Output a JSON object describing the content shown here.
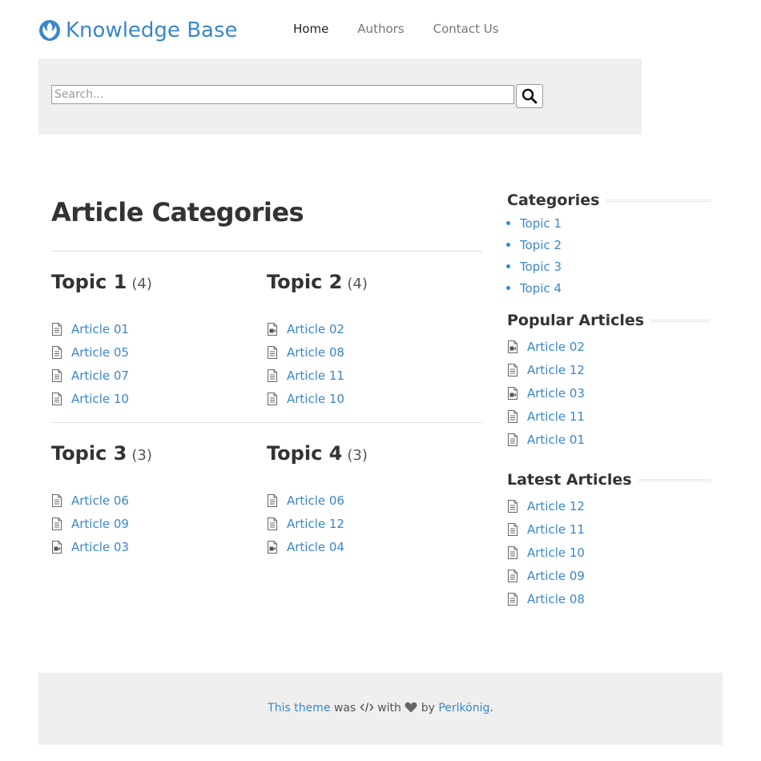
{
  "brand": {
    "name": "Knowledge Base",
    "icon": "rebel-alliance-icon",
    "color": "#3a87c8"
  },
  "nav": [
    {
      "label": "Home",
      "active": true
    },
    {
      "label": "Authors",
      "active": false
    },
    {
      "label": "Contact Us",
      "active": false
    }
  ],
  "search": {
    "placeholder": "Search...",
    "value": "",
    "button_icon": "search-icon"
  },
  "main": {
    "title": "Article Categories",
    "topics": [
      {
        "name": "Topic 1",
        "count": "(4)",
        "articles": [
          {
            "label": "Article 01",
            "icon": "document-icon"
          },
          {
            "label": "Article 05",
            "icon": "document-icon"
          },
          {
            "label": "Article 07",
            "icon": "document-icon"
          },
          {
            "label": "Article 10",
            "icon": "document-icon"
          }
        ]
      },
      {
        "name": "Topic 2",
        "count": "(4)",
        "articles": [
          {
            "label": "Article 02",
            "icon": "video-document-icon"
          },
          {
            "label": "Article 08",
            "icon": "document-icon"
          },
          {
            "label": "Article 11",
            "icon": "document-icon"
          },
          {
            "label": "Article 10",
            "icon": "document-icon"
          }
        ]
      },
      {
        "name": "Topic 3",
        "count": "(3)",
        "articles": [
          {
            "label": "Article 06",
            "icon": "document-icon"
          },
          {
            "label": "Article 09",
            "icon": "document-icon"
          },
          {
            "label": "Article 03",
            "icon": "video-document-icon"
          }
        ]
      },
      {
        "name": "Topic 4",
        "count": "(3)",
        "articles": [
          {
            "label": "Article 06",
            "icon": "document-icon"
          },
          {
            "label": "Article 12",
            "icon": "document-icon"
          },
          {
            "label": "Article 04",
            "icon": "video-document-icon"
          }
        ]
      }
    ]
  },
  "sidebar": {
    "categories": {
      "title": "Categories",
      "items": [
        "Topic 1",
        "Topic 2",
        "Topic 3",
        "Topic 4"
      ]
    },
    "popular": {
      "title": "Popular Articles",
      "items": [
        {
          "label": "Article 02",
          "icon": "video-document-icon"
        },
        {
          "label": "Article 12",
          "icon": "document-icon"
        },
        {
          "label": "Article 03",
          "icon": "video-document-icon"
        },
        {
          "label": "Article 11",
          "icon": "document-icon"
        },
        {
          "label": "Article 01",
          "icon": "document-icon"
        }
      ]
    },
    "latest": {
      "title": "Latest Articles",
      "items": [
        {
          "label": "Article 12",
          "icon": "document-icon"
        },
        {
          "label": "Article 11",
          "icon": "document-icon"
        },
        {
          "label": "Article 10",
          "icon": "document-icon"
        },
        {
          "label": "Article 09",
          "icon": "document-icon"
        },
        {
          "label": "Article 08",
          "icon": "document-icon"
        }
      ]
    }
  },
  "footer": {
    "link1": "This theme",
    "text1": "was",
    "code_icon": "code-icon",
    "text2": "with",
    "heart_icon": "heart-icon",
    "text3": "by",
    "link2": "Perlkönig",
    "text4": "."
  },
  "colors": {
    "link": "#3a87c8",
    "band": "#efefef",
    "heading": "#333333"
  }
}
